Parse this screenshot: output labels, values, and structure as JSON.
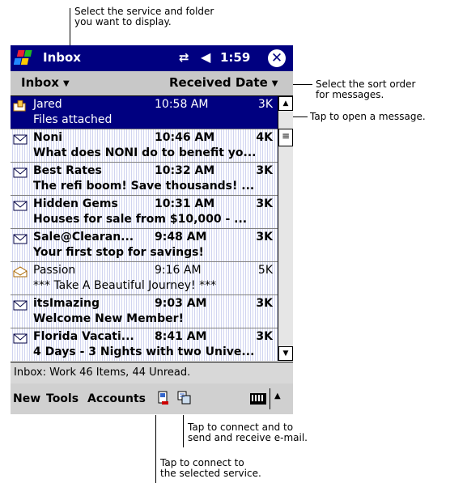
{
  "callouts": {
    "top": "Select the service and folder\nyou want to display.",
    "sort": "Select the sort order\nfor messages.",
    "open": "Tap to open a message.",
    "send": "Tap to connect and to\nsend and receive e-mail.",
    "connect": "Tap to connect to\nthe selected service."
  },
  "titlebar": {
    "title": "Inbox",
    "connectivity_icon": "connectivity-arrows",
    "volume_icon": "speaker",
    "time": "1:59",
    "close_icon": "close"
  },
  "toolbar": {
    "folder": "Inbox",
    "sort": "Received Date"
  },
  "messages": [
    {
      "from": "Jared",
      "time": "10:58 AM",
      "size": "3K",
      "subject": "Files attached",
      "unread": false,
      "selected": true,
      "icon": "attachment-envelope"
    },
    {
      "from": "Noni",
      "time": "10:46 AM",
      "size": "4K",
      "subject": "What does NONI do to benefit yo...",
      "unread": true,
      "selected": false,
      "icon": "envelope"
    },
    {
      "from": "Best Rates",
      "time": "10:32 AM",
      "size": "3K",
      "subject": "The refi boom! Save thousands! ...",
      "unread": true,
      "selected": false,
      "icon": "envelope"
    },
    {
      "from": "Hidden Gems",
      "time": "10:31 AM",
      "size": "3K",
      "subject": "Houses for sale from $10,000 - ...",
      "unread": true,
      "selected": false,
      "icon": "envelope"
    },
    {
      "from": "Sale@Clearan...",
      "time": "9:48 AM",
      "size": "3K",
      "subject": "Your first stop for savings!",
      "unread": true,
      "selected": false,
      "icon": "envelope"
    },
    {
      "from": "Passion",
      "time": "9:16 AM",
      "size": "5K",
      "subject": "*** Take A Beautiful Journey! ***",
      "unread": false,
      "selected": false,
      "icon": "open-envelope"
    },
    {
      "from": "itsImazing",
      "time": "9:03 AM",
      "size": "3K",
      "subject": "Welcome New Member!",
      "unread": true,
      "selected": false,
      "icon": "envelope"
    },
    {
      "from": "Florida Vacati...",
      "time": "8:41 AM",
      "size": "3K",
      "subject": "4 Days - 3 Nights with two Unive...",
      "unread": true,
      "selected": false,
      "icon": "envelope"
    }
  ],
  "status": "Inbox: Work  46 Items, 44 Unread.",
  "menu": {
    "new": "New",
    "tools": "Tools",
    "accounts": "Accounts"
  },
  "colors": {
    "titlebar": "#000080",
    "selection": "#000080"
  }
}
